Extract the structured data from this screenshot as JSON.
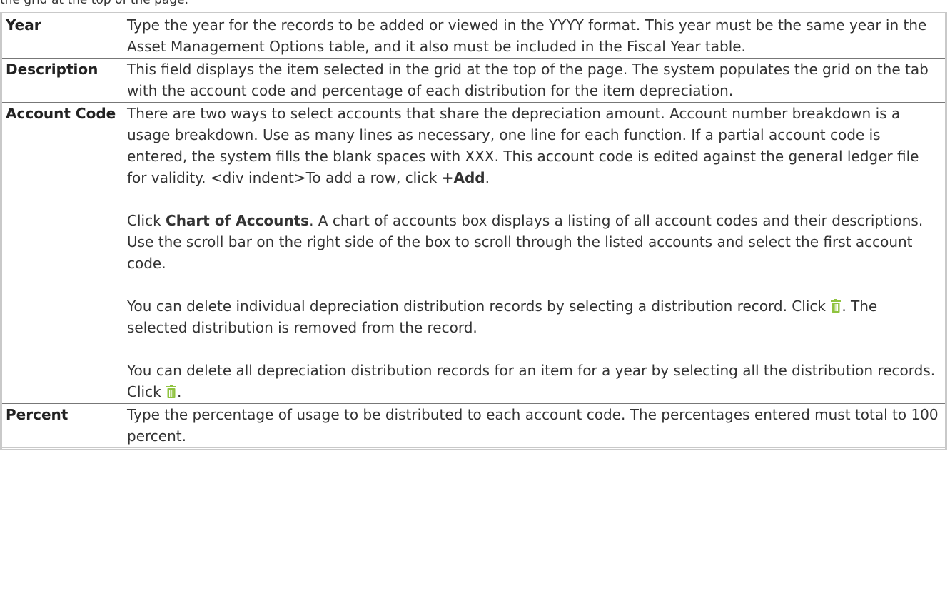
{
  "intro_partial": "the grid at the top of the page.",
  "rows": [
    {
      "term": "Year",
      "text": "Type the year for the records to be added or viewed in the YYYY format. This year must be the same year in the Asset Management Options table, and it also must be included in the Fiscal Year table."
    },
    {
      "term": "Description",
      "text": "This field displays the item selected in the grid at the top of the page. The system populates the grid on the tab with the account code and percentage of each distribution for the item depreciation."
    },
    {
      "term": "Account Code",
      "p1": "There are two ways to select accounts that share the depreciation amount. Account number breakdown is a usage breakdown. Use as many lines as necessary, one line for each function. If a partial account code is entered, the system fills the blank spaces with XXX. This account code is edited against the general ledger file for validity. <div indent>To add a row, click ",
      "p1_bold": "+Add",
      "p1_end": ".",
      "p2_pre": "Click ",
      "p2_bold": "Chart of Accounts",
      "p2_post": ". A chart of accounts box displays a listing of all account codes and their descriptions. Use the scroll bar on the right side of the box to scroll through the listed accounts and select the first account code.",
      "p3_pre": "You can delete individual depreciation distribution records by selecting a distribution record. Click ",
      "p3_post": ". The selected distribution is removed from the record.",
      "p4_pre": "You can delete all depreciation distribution records for an item for a year by selecting all the distribution records. Click ",
      "p4_post": "."
    },
    {
      "term": "Percent",
      "text": "Type the percentage of usage to be distributed to each account code. The percentages entered must total to 100 percent."
    }
  ],
  "colors": {
    "trash_icon": "#8fc33f",
    "border": "#777777"
  },
  "icons": {
    "delete": "trash-icon"
  }
}
